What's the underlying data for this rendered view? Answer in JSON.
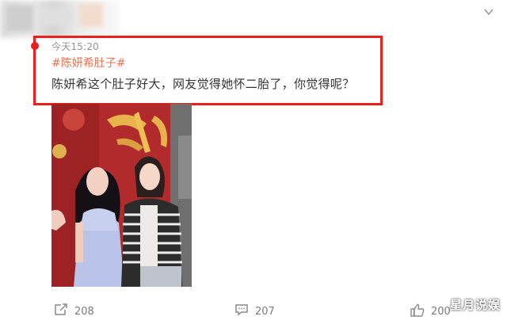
{
  "post": {
    "timestamp": "今天15:20",
    "hashtag": "#陈妍希肚子#",
    "text": "陈妍希这个肚子好大，网友觉得她怀二胎了，你觉得呢？"
  },
  "actions": {
    "repost_count": "208",
    "comment_count": "207",
    "like_count": "200"
  },
  "watermark": "星月说娱",
  "colors": {
    "highlight": "#e8201e",
    "hashtag": "#eb7350",
    "meta_text": "#939393"
  },
  "icons": {
    "repost": "repost-icon",
    "comment": "comment-icon",
    "like": "thumbs-up-icon",
    "more": "chevron-down-icon"
  }
}
